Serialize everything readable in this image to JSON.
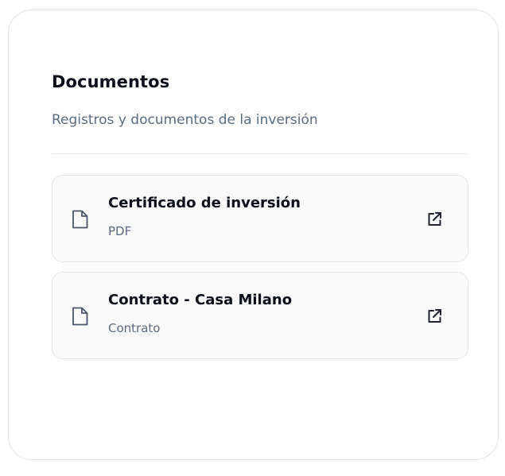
{
  "section": {
    "title": "Documentos",
    "subtitle": "Registros y documentos de la inversión"
  },
  "documents": [
    {
      "name": "Certificado de inversión",
      "type": "PDF",
      "icon": "file-icon",
      "action_icon": "external-link-icon"
    },
    {
      "name": "Contrato - Casa Milano",
      "type": "Contrato",
      "icon": "file-icon",
      "action_icon": "external-link-icon"
    }
  ],
  "colors": {
    "title": "#0b0f19",
    "muted": "#5b6b80",
    "item_bg": "#fafafb",
    "item_border": "#e3e8ee"
  }
}
